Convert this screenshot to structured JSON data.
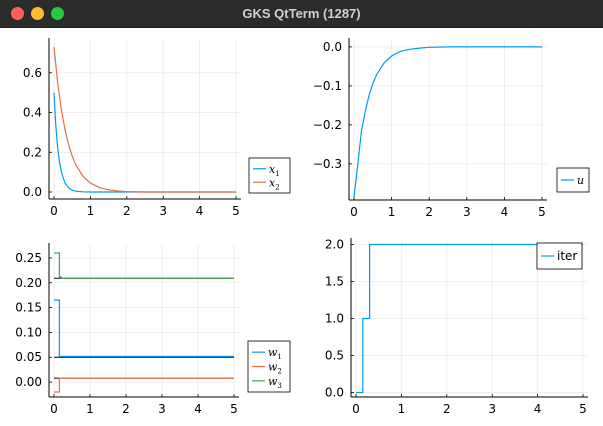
{
  "window": {
    "title": "GKS QtTerm (1287)",
    "controls": [
      "close",
      "minimize",
      "zoom"
    ]
  },
  "chart_data": [
    {
      "type": "line",
      "x_range": [
        0,
        5
      ],
      "ylim": [
        -0.01,
        0.75
      ],
      "xticks": [
        "0",
        "1",
        "2",
        "3",
        "4",
        "5"
      ],
      "yticks": [
        "0.0",
        "0.2",
        "0.4",
        "0.6"
      ],
      "ytick_values": [
        0,
        0.2,
        0.4,
        0.6
      ],
      "grid": true,
      "legend_position": "bottom-right-outside",
      "series": [
        {
          "name": "x",
          "subscript": "1",
          "color": "#009AFA",
          "x": [
            0,
            0.05,
            0.1,
            0.15,
            0.2,
            0.3,
            0.4,
            0.5,
            0.6,
            0.8,
            1.0,
            1.25,
            1.5,
            2.0,
            2.5,
            3.0,
            5.0
          ],
          "y": [
            0.5,
            0.335,
            0.225,
            0.151,
            0.101,
            0.046,
            0.021,
            0.009,
            0.004,
            0.001,
            0.0,
            0.0,
            0.0,
            0.0,
            0.0,
            0.0,
            0.0
          ]
        },
        {
          "name": "x",
          "subscript": "2",
          "color": "#E36F47",
          "x": [
            0,
            0.1,
            0.2,
            0.3,
            0.4,
            0.5,
            0.6,
            0.8,
            1.0,
            1.25,
            1.5,
            1.75,
            2.0,
            2.5,
            3.0,
            4.0,
            5.0
          ],
          "y": [
            0.73,
            0.552,
            0.418,
            0.316,
            0.239,
            0.181,
            0.137,
            0.078,
            0.045,
            0.022,
            0.011,
            0.005,
            0.002,
            0.0,
            0.0,
            0.0,
            0.0
          ]
        }
      ]
    },
    {
      "type": "line",
      "x_range": [
        0,
        5
      ],
      "ylim": [
        -0.385,
        0.01
      ],
      "xticks": [
        "0",
        "1",
        "2",
        "3",
        "4",
        "5"
      ],
      "yticks": [
        "0.0",
        "−0.1",
        "−0.2",
        "−0.3"
      ],
      "ytick_values": [
        0,
        -0.1,
        -0.2,
        -0.3
      ],
      "grid": true,
      "legend_position": "bottom-right-outside",
      "series": [
        {
          "name": "u",
          "subscript": "",
          "color": "#009AFA",
          "x": [
            0,
            0.1,
            0.2,
            0.3,
            0.4,
            0.5,
            0.6,
            0.8,
            1.0,
            1.25,
            1.5,
            1.75,
            2.0,
            2.5,
            3.0,
            4.0,
            5.0
          ],
          "y": [
            -0.385,
            -0.3,
            -0.215,
            -0.165,
            -0.125,
            -0.094,
            -0.071,
            -0.041,
            -0.023,
            -0.011,
            -0.006,
            -0.003,
            -0.001,
            0.0,
            0.0,
            0.0,
            0.0
          ]
        }
      ]
    },
    {
      "type": "line",
      "x_range": [
        0,
        5
      ],
      "ylim": [
        -0.022,
        0.27
      ],
      "xticks": [
        "0",
        "1",
        "2",
        "3",
        "4",
        "5"
      ],
      "yticks": [
        "0.00",
        "0.05",
        "0.10",
        "0.15",
        "0.20",
        "0.25"
      ],
      "ytick_values": [
        0,
        0.05,
        0.1,
        0.15,
        0.2,
        0.25
      ],
      "grid": true,
      "legend_position": "bottom-right-outside",
      "series": [
        {
          "name": "w",
          "subscript": "1",
          "color": "#009AFA",
          "x": [
            0,
            0.15,
            0.15,
            5
          ],
          "y": [
            0.165,
            0.165,
            0.052,
            0.052
          ]
        },
        {
          "name": "w",
          "subscript": "2",
          "color": "#E36F47",
          "x": [
            0,
            0.15,
            0.15,
            5
          ],
          "y": [
            -0.02,
            -0.02,
            0.008,
            0.008
          ]
        },
        {
          "name": "w",
          "subscript": "3",
          "color": "#3EA44E",
          "x": [
            0,
            0.15,
            0.15,
            0.2,
            0.2,
            5
          ],
          "y": [
            0.26,
            0.26,
            0.212,
            0.212,
            0.209,
            0.209
          ]
        }
      ],
      "reference_lines": [
        0.209,
        0.05,
        0.008
      ]
    },
    {
      "type": "line",
      "x_range": [
        0,
        5
      ],
      "ylim": [
        -0.02,
        2.02
      ],
      "xticks": [
        "0",
        "1",
        "2",
        "3",
        "4",
        "5"
      ],
      "yticks": [
        "0.0",
        "0.5",
        "1.0",
        "1.5",
        "2.0"
      ],
      "ytick_values": [
        0,
        0.5,
        1,
        1.5,
        2
      ],
      "grid": true,
      "legend_position": "top-right",
      "series": [
        {
          "name": "iter",
          "subscript": "",
          "color": "#009AFA",
          "x": [
            0,
            0.15,
            0.15,
            0.3,
            0.3,
            5
          ],
          "y": [
            0,
            0,
            1,
            1,
            2,
            2
          ]
        }
      ]
    }
  ]
}
